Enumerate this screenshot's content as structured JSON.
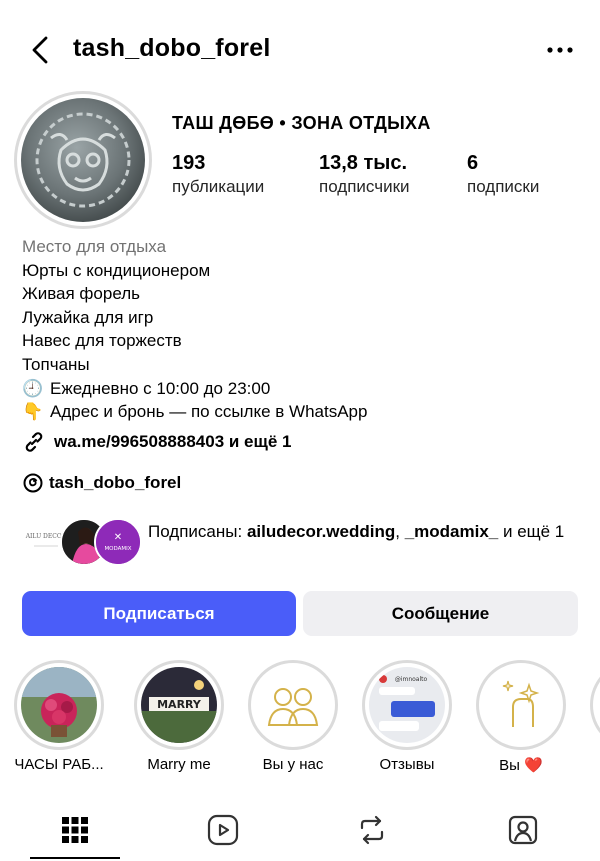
{
  "header": {
    "username": "tash_dobo_forel"
  },
  "profile": {
    "name": "ТАШ ДӨБӨ • ЗОНА ОТДЫХА",
    "stats": [
      {
        "num": "193",
        "label": "публикации"
      },
      {
        "num": "13,8 тыс.",
        "label": "подписчики"
      },
      {
        "num": "6",
        "label": "подписки"
      }
    ]
  },
  "bio": {
    "category": "Место для отдыха",
    "lines": [
      "Юрты с кондиционером",
      "Живая форель",
      "Лужайка для игр",
      "Навес для торжеств",
      "Топчаны"
    ],
    "hours": "Ежедневно с 10:00 до 23:00",
    "address": "Адрес и бронь — по ссылке в WhatsApp",
    "hours_emoji": "🕘",
    "address_emoji": "👇"
  },
  "link": {
    "text": "wa.me/996508888403 и ещё 1"
  },
  "threads": {
    "text": "tash_dobo_forel"
  },
  "followed_by": {
    "prefix": "Подписаны: ",
    "account1": "ailudecor.wedding",
    "sep": ", ",
    "account2": "_modamix_",
    "suffix": " и ещё 1",
    "avatar1_text": "AILU DECOR",
    "avatar3_text": "MODAMIX"
  },
  "buttons": {
    "follow": "Подписаться",
    "message": "Сообщение"
  },
  "highlights": [
    {
      "label": "ЧАСЫ РАБ..."
    },
    {
      "label": "Marry me",
      "img_text": "MARRY"
    },
    {
      "label": "Вы у нас"
    },
    {
      "label": "Отзывы",
      "img_text": "@imnoalto"
    },
    {
      "label": "Вы ❤️"
    }
  ],
  "colors": {
    "accent": "#4a5df9",
    "secondary_button": "#efeff2",
    "muted_text": "#737373"
  }
}
